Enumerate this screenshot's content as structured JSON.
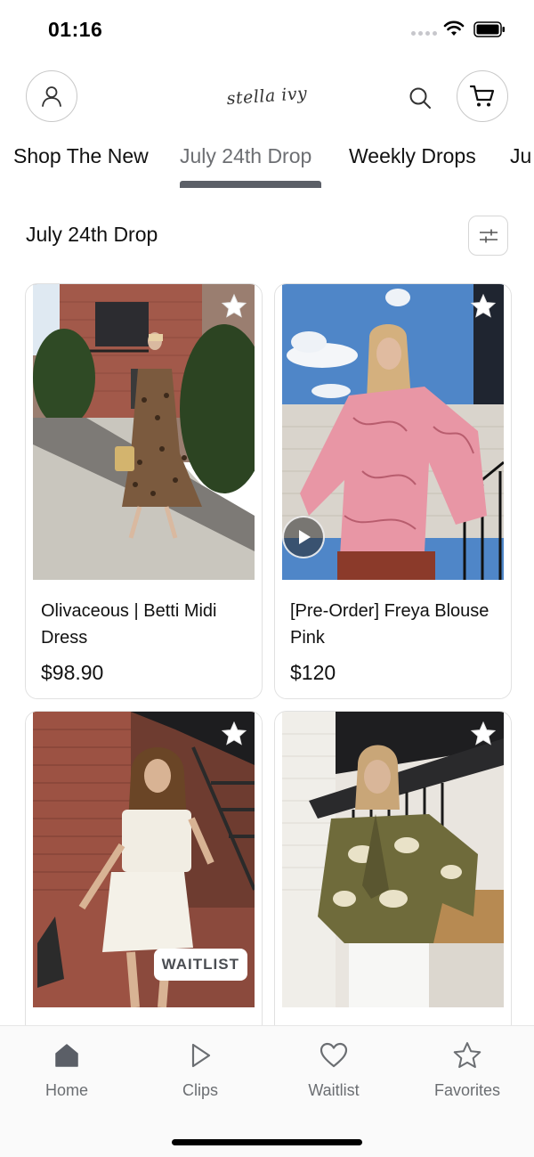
{
  "status_bar": {
    "time": "01:16"
  },
  "header": {
    "logo_text": "stella ivy",
    "icons": [
      "account-icon",
      "search-icon",
      "cart-icon"
    ]
  },
  "tabs": [
    {
      "label": "Shop The New",
      "active": false
    },
    {
      "label": "July 24th Drop",
      "active": true
    },
    {
      "label": "Weekly Drops",
      "active": false
    },
    {
      "label": "Ju",
      "active": false
    }
  ],
  "section": {
    "title": "July 24th Drop"
  },
  "products": [
    {
      "name": "Olivaceous | Betti Midi Dress",
      "price": "$98.90",
      "video": false,
      "badge": ""
    },
    {
      "name": "[Pre-Order] Freya Blouse Pink",
      "price": "$120",
      "video": true,
      "badge": ""
    },
    {
      "name": "",
      "price": "",
      "video": false,
      "badge": "WAITLIST"
    },
    {
      "name": "",
      "price": "",
      "video": false,
      "badge": ""
    }
  ],
  "bottom_nav": [
    {
      "label": "Home",
      "icon": "home-icon",
      "active": true
    },
    {
      "label": "Clips",
      "icon": "play-icon",
      "active": false
    },
    {
      "label": "Waitlist",
      "icon": "heart-icon",
      "active": false
    },
    {
      "label": "Favorites",
      "icon": "star-icon",
      "active": false
    }
  ],
  "colors": {
    "accent": "#5b5f67",
    "nav_label": "#6b6e72",
    "divider": "#e3e5e8"
  }
}
